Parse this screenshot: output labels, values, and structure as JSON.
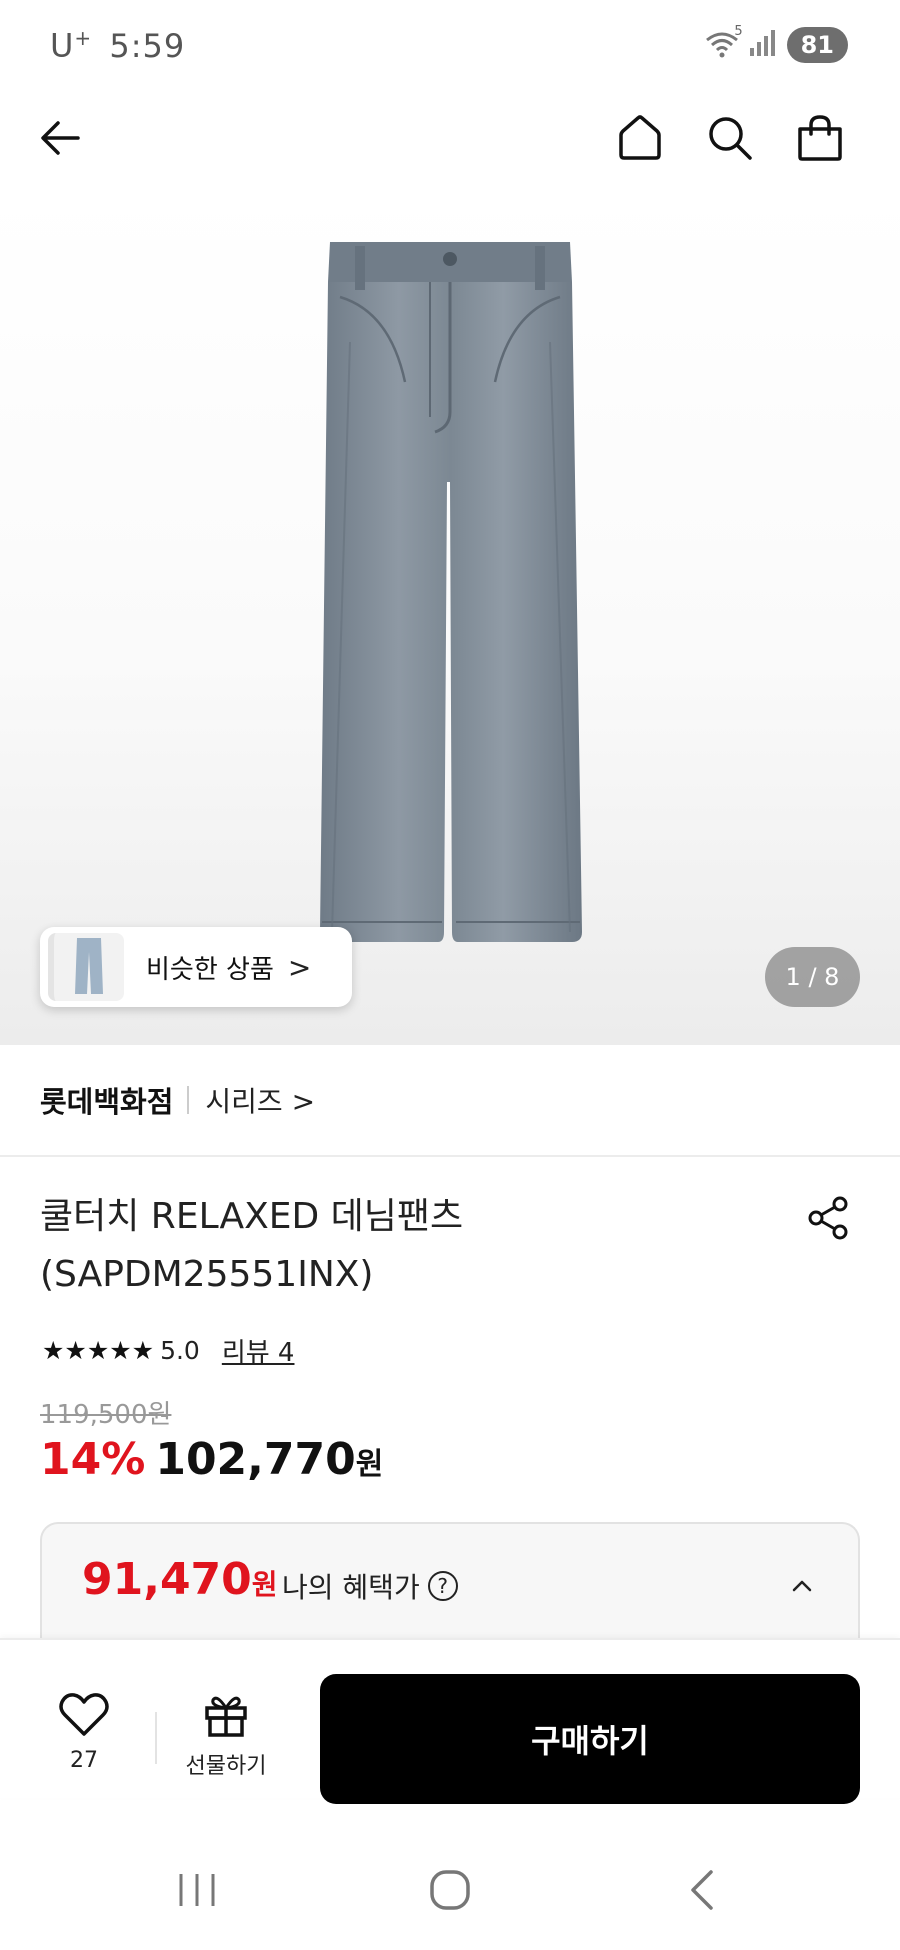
{
  "status_bar": {
    "carrier": "U",
    "carrier_sup": "+",
    "time": "5:59",
    "battery": "81",
    "wifi_gen": "5"
  },
  "top_nav": {
    "icons": [
      "back-arrow-icon",
      "home-icon",
      "search-icon",
      "shopping-bag-icon"
    ]
  },
  "gallery": {
    "similar_label": "비슷한 상품",
    "similar_chevron": ">",
    "page_counter": "1 / 8"
  },
  "brand": {
    "name": "롯데백화점",
    "series": "시리즈 >"
  },
  "product": {
    "title_line1": "쿨터치 RELAXED 데님팬츠",
    "title_line2": "(SAPDM25551INX)",
    "stars": "★★★★★",
    "rating": "5.0",
    "review_link": "리뷰 4",
    "original_price": "119,500원",
    "discount": "14%",
    "sale_price": "102,770",
    "currency": "원"
  },
  "benefit": {
    "price": "91,470",
    "currency": "원",
    "label": "나의 혜택가",
    "help": "?"
  },
  "bottom_bar": {
    "like_count": "27",
    "gift_label": "선물하기",
    "buy_label": "구매하기"
  },
  "colors": {
    "discount_red": "#e0141e",
    "buy_button": "#000000",
    "denim": "#7e8a96"
  }
}
